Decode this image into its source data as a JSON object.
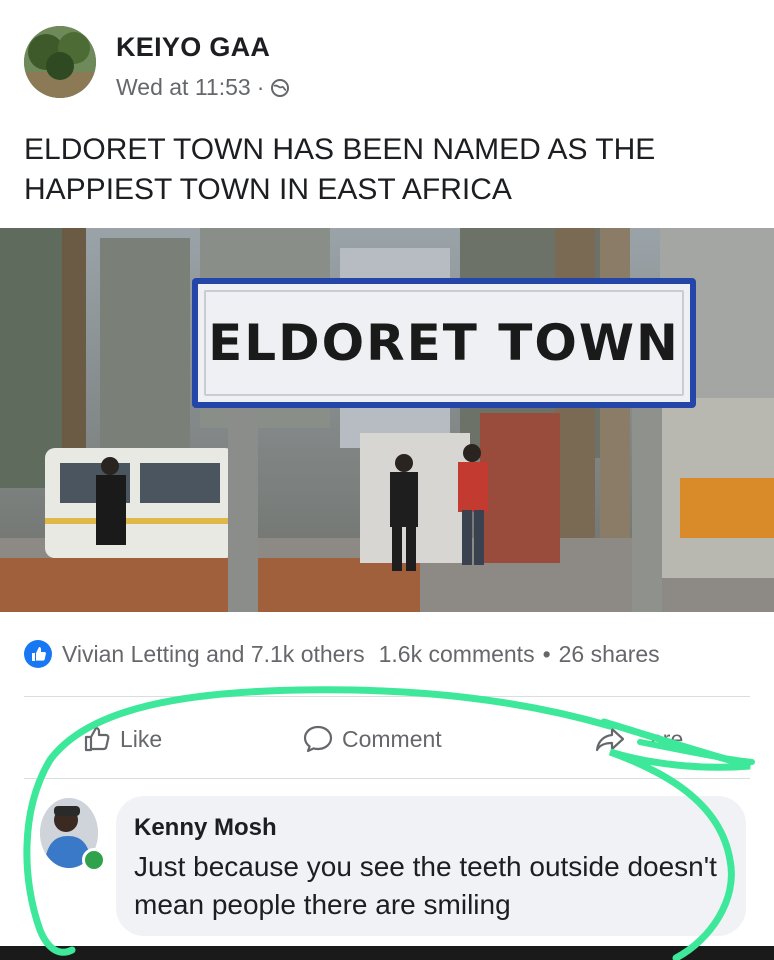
{
  "post": {
    "author": "KEIYO GAA",
    "timestamp": "Wed at 11:53",
    "separator": "·",
    "privacy_icon": "globe-icon",
    "text": "ELDORET TOWN HAS BEEN NAMED AS THE HAPPIEST TOWN IN EAST AFRICA",
    "photo_sign_text": "ELDORET TOWN"
  },
  "stats": {
    "reactions": "Vivian Letting and 7.1k others",
    "comments": "1.6k comments",
    "dot": "•",
    "shares": "26 shares"
  },
  "actions": {
    "like": "Like",
    "comment": "Comment",
    "share": "are"
  },
  "comment": {
    "author": "Kenny Mosh",
    "text": "Just because you see the teeth outside doesn't mean people there are smiling"
  },
  "colors": {
    "facebook_blue": "#1877f2",
    "annotation_green": "#3ee89a",
    "sign_blue": "#2446a8",
    "online_green": "#31a24c"
  }
}
